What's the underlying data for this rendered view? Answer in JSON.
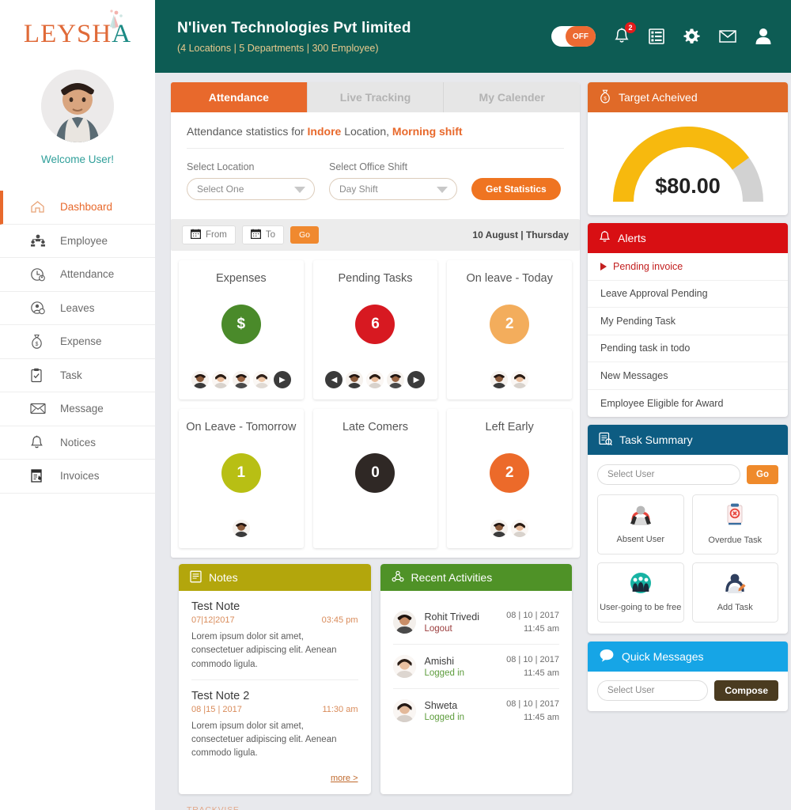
{
  "brand": {
    "logo_text_main": "LEYSH",
    "logo_text_accent": "A",
    "footer": "TRACKVISE"
  },
  "sidebar": {
    "welcome": "Welcome User!",
    "avatar_name": "user-avatar",
    "items": [
      {
        "label": "Dashboard",
        "icon": "home-icon",
        "active": true
      },
      {
        "label": "Employee",
        "icon": "people-icon",
        "active": false
      },
      {
        "label": "Attendance",
        "icon": "clock-user-icon",
        "active": false
      },
      {
        "label": "Leaves",
        "icon": "user-circle-icon",
        "active": false
      },
      {
        "label": "Expense",
        "icon": "money-bag-icon",
        "active": false
      },
      {
        "label": "Task",
        "icon": "clipboard-icon",
        "active": false
      },
      {
        "label": "Message",
        "icon": "envelope-icon",
        "active": false
      },
      {
        "label": "Notices",
        "icon": "bell-icon",
        "active": false
      },
      {
        "label": "Invoices",
        "icon": "invoice-icon",
        "active": false
      }
    ]
  },
  "topbar": {
    "org_name": "N'liven Technologies Pvt limited",
    "org_meta": "(4 Locations | 5 Departments | 300 Employee)",
    "toggle_label": "OFF",
    "notification_count": "2",
    "icons": [
      "bell-icon",
      "list-icon",
      "gear-icon",
      "mail-icon",
      "user-icon"
    ]
  },
  "attendance": {
    "tabs": [
      {
        "label": "Attendance",
        "active": true
      },
      {
        "label": "Live Tracking",
        "active": false
      },
      {
        "label": "My Calender",
        "active": false
      }
    ],
    "stats_prefix": "Attendance statistics for ",
    "stats_location": "Indore",
    "stats_mid": " Location, ",
    "stats_shift": "Morning shift",
    "location_label": "Select Location",
    "location_value": "Select One",
    "shift_label": "Select Office Shift",
    "shift_value": "Day Shift",
    "get_statistics": "Get Statistics",
    "from_label": "From",
    "to_label": "To",
    "go_label": "Go",
    "date_info": "10 August | Thursday"
  },
  "stat_cards": [
    {
      "title": "Expenses",
      "value": "$",
      "color": "#4a8a2a",
      "faces": 4,
      "prev": false,
      "next": true
    },
    {
      "title": "Pending Tasks",
      "value": "6",
      "color": "#d71921",
      "faces": 3,
      "prev": true,
      "next": true
    },
    {
      "title": "On leave - Today",
      "value": "2",
      "color": "#f3ad5c",
      "faces": 2,
      "prev": false,
      "next": false
    },
    {
      "title": "On Leave - Tomorrow",
      "value": "1",
      "color": "#b8bf14",
      "faces": 1,
      "prev": false,
      "next": false
    },
    {
      "title": "Late Comers",
      "value": "0",
      "color": "#2f2825",
      "faces": 0,
      "prev": false,
      "next": false
    },
    {
      "title": "Left Early",
      "value": "2",
      "color": "#ec6a2a",
      "faces": 2,
      "prev": false,
      "next": false
    }
  ],
  "notes": {
    "header": "Notes",
    "header_icon": "notes-icon",
    "header_color": "#b3a60c",
    "more_label": "more >",
    "items": [
      {
        "title": "Test Note",
        "date": "07|12|2017",
        "time": "03:45 pm",
        "body": "Lorem ipsum dolor sit amet, consectetuer adipiscing elit. Aenean commodo ligula."
      },
      {
        "title": "Test Note 2",
        "date": "08 |15 | 2017",
        "time": "11:30 am",
        "body": "Lorem ipsum dolor sit amet, consectetuer adipiscing elit. Aenean commodo ligula."
      }
    ]
  },
  "activities": {
    "header": "Recent Activities",
    "header_icon": "activity-icon",
    "header_color": "#4f9227",
    "items": [
      {
        "name": "Rohit Trivedi",
        "state": "Logout",
        "state_color": "#9a3b3b",
        "date": "08 | 10 | 2017",
        "time": "11:45 am"
      },
      {
        "name": "Amishi",
        "state": "Logged in",
        "state_color": "#5d9c3c",
        "date": "08 | 10 | 2017",
        "time": "11:45 am"
      },
      {
        "name": "Shweta",
        "state": "Logged in",
        "state_color": "#5d9c3c",
        "date": "08 | 10 | 2017",
        "time": "11:45 am"
      }
    ]
  },
  "target": {
    "header": "Target Acheived",
    "header_icon": "money-bag-icon",
    "header_color": "#e06a28",
    "value": "$80.00",
    "percent": 80,
    "arc_color": "#f7b90e",
    "track_color": "#d2d2d2"
  },
  "alerts": {
    "header": "Alerts",
    "header_icon": "bell-icon",
    "header_color": "#d80f13",
    "items": [
      {
        "label": "Pending invoice",
        "hot": true
      },
      {
        "label": "Leave Approval Pending",
        "hot": false
      },
      {
        "label": "My Pending Task",
        "hot": false
      },
      {
        "label": "Pending task in todo",
        "hot": false
      },
      {
        "label": "New Messages",
        "hot": false
      },
      {
        "label": "Employee Eligible for Award",
        "hot": false
      }
    ]
  },
  "task_summary": {
    "header": "Task Summary",
    "header_icon": "task-summary-icon",
    "header_color": "#0d5c82",
    "select_value": "Select User",
    "go_label": "Go",
    "tiles": [
      {
        "label": "Absent User",
        "icon": "absent-user-icon"
      },
      {
        "label": "Overdue Task",
        "icon": "overdue-task-icon"
      },
      {
        "label": "User-going to be free",
        "icon": "free-users-icon"
      },
      {
        "label": "Add Task",
        "icon": "add-task-icon"
      }
    ]
  },
  "quick_messages": {
    "header": "Quick Messages",
    "header_icon": "chat-bubble-icon",
    "header_color": "#16a5e6",
    "select_value": "Select User",
    "compose_label": "Compose"
  }
}
